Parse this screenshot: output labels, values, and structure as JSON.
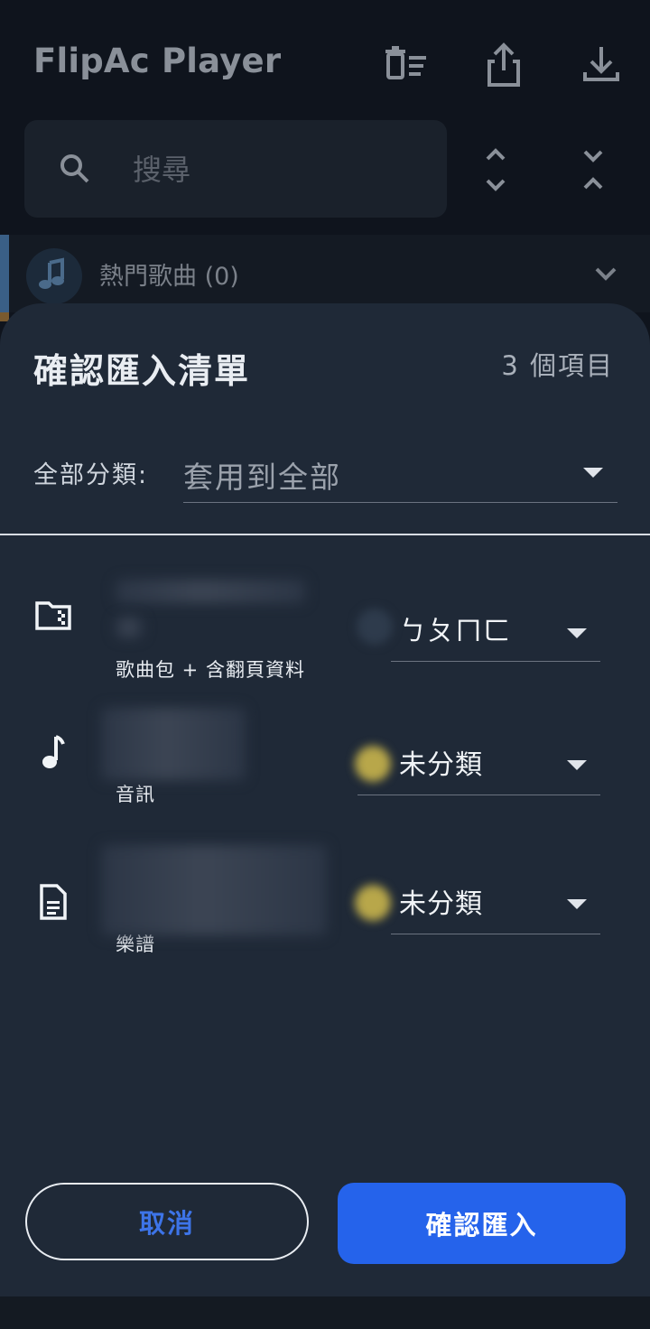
{
  "app": {
    "title": "FlipAc Player",
    "toolbar": {
      "clear_icon": "playlist-remove-icon",
      "export_icon": "share-upload-icon",
      "import_icon": "download-icon"
    }
  },
  "search": {
    "placeholder": "搜尋",
    "value": "",
    "icon": "search-icon"
  },
  "sort": {
    "expand_icon": "unfold-more-icon",
    "collapse_icon": "unfold-less-icon"
  },
  "group": {
    "label": "熱門歌曲 (0)",
    "icon": "music-note-icon"
  },
  "sheet": {
    "title": "確認匯入清單",
    "count": "3 個項目",
    "all_category_label": "全部分類:",
    "all_category_value": "套用到全部",
    "items": [
      {
        "icon": "folder-zip-icon",
        "type": "歌曲包 + 含翻頁資料",
        "category": "ㄅㄆㄇㄈ",
        "swatch_color": "#2e3b4c"
      },
      {
        "icon": "music-note-icon",
        "type": "音訊",
        "category": "未分類",
        "swatch_color": "#b8a74a"
      },
      {
        "icon": "document-icon",
        "type": "樂譜",
        "category": "未分類",
        "swatch_color": "#b8a74a"
      }
    ]
  },
  "buttons": {
    "cancel": "取消",
    "confirm": "確認匯入"
  },
  "colors": {
    "accent": "#2563eb",
    "sheet_background": "#1f2937",
    "app_background": "#0f141d"
  }
}
